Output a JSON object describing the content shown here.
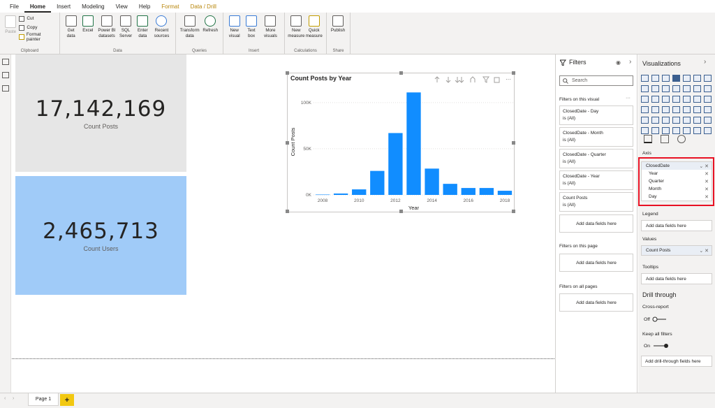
{
  "menu": {
    "tabs": [
      "File",
      "Home",
      "Insert",
      "Modeling",
      "View",
      "Help",
      "Format",
      "Data / Drill"
    ],
    "active": "Home"
  },
  "ribbon": {
    "clipboard": {
      "paste": "Paste",
      "cut": "Cut",
      "copy": "Copy",
      "format_painter": "Format painter",
      "label": "Clipboard"
    },
    "data": {
      "get_data": "Get\ndata",
      "excel": "Excel",
      "pbi_datasets": "Power BI\ndatasets",
      "sql": "SQL\nServer",
      "enter_data": "Enter\ndata",
      "recent": "Recent\nsources",
      "label": "Data"
    },
    "queries": {
      "transform": "Transform\ndata",
      "refresh": "Refresh",
      "label": "Queries"
    },
    "insert": {
      "new_visual": "New\nvisual",
      "text_box": "Text\nbox",
      "more_visuals": "More\nvisuals",
      "label": "Insert"
    },
    "calculations": {
      "new_measure": "New\nmeasure",
      "quick_measure": "Quick\nmeasure",
      "label": "Calculations"
    },
    "share": {
      "publish": "Publish",
      "label": "Share"
    }
  },
  "cards": {
    "posts": {
      "value": "17,142,169",
      "label": "Count Posts",
      "bg": "#e6e6e6"
    },
    "users": {
      "value": "2,465,713",
      "label": "Count Users",
      "bg": "#a0cbf8"
    }
  },
  "chart_data": {
    "type": "bar",
    "title": "Count Posts by Year",
    "xlabel": "Year",
    "ylabel": "Count Posts",
    "categories": [
      2008,
      2009,
      2010,
      2011,
      2012,
      2013,
      2014,
      2015,
      2016,
      2017,
      2018
    ],
    "x_tick_labels": [
      "2008",
      "2010",
      "2012",
      "2014",
      "2016",
      "2018"
    ],
    "values": [
      400,
      1500,
      6000,
      26000,
      67000,
      111000,
      28500,
      12000,
      7500,
      7500,
      4500
    ],
    "ylim": [
      0,
      115000
    ],
    "y_ticks": [
      {
        "v": 0,
        "label": "0K"
      },
      {
        "v": 50000,
        "label": "50K"
      },
      {
        "v": 100000,
        "label": "100K"
      }
    ],
    "color": "#118dff"
  },
  "filters": {
    "title": "Filters",
    "search_placeholder": "Search",
    "on_visual": "Filters on this visual",
    "items": [
      {
        "field": "ClosedDate - Day",
        "state": "is (All)"
      },
      {
        "field": "ClosedDate - Month",
        "state": "is (All)"
      },
      {
        "field": "ClosedDate - Quarter",
        "state": "is (All)"
      },
      {
        "field": "ClosedDate - Year",
        "state": "is (All)"
      },
      {
        "field": "Count Posts",
        "state": "is (All)"
      }
    ],
    "add_here": "Add data fields here",
    "on_page": "Filters on this page",
    "on_all": "Filters on all pages"
  },
  "viz": {
    "title": "Visualizations",
    "axis_label": "Axis",
    "axis_field": "ClosedDate",
    "axis_sub": [
      "Year",
      "Quarter",
      "Month",
      "Day"
    ],
    "legend_label": "Legend",
    "values_label": "Values",
    "values_field": "Count Posts",
    "tooltips_label": "Tooltips",
    "add_here": "Add data fields here",
    "drill_title": "Drill through",
    "cross_report": "Cross-report",
    "cross_state": "Off",
    "keep_filters": "Keep all filters",
    "keep_state": "On",
    "add_drill": "Add drill-through fields here",
    "highlight_color": "#e81123"
  },
  "pages": {
    "tab": "Page 1",
    "add": "+"
  }
}
